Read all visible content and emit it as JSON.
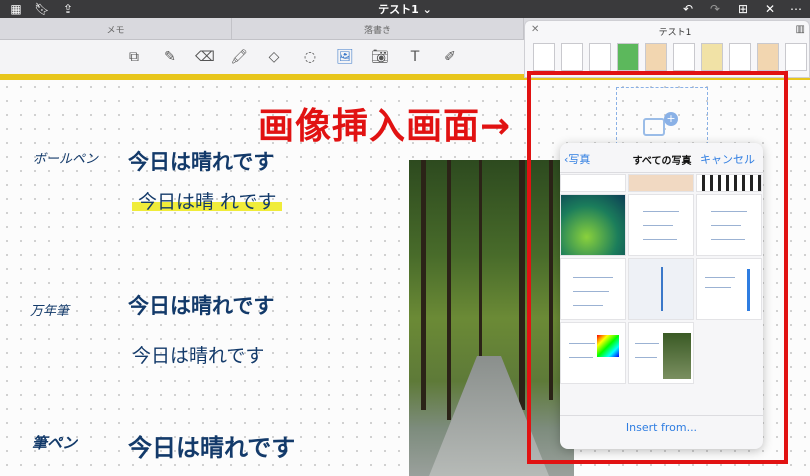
{
  "document": {
    "title": "テスト1 ⌄"
  },
  "tabs": [
    {
      "label": "メモ"
    },
    {
      "label": "落書き"
    }
  ],
  "toolbar": {
    "tools": [
      "page-icon",
      "pen-icon",
      "eraser-icon",
      "highlighter-icon",
      "shapes-icon",
      "lasso-icon",
      "image-icon",
      "camera-icon",
      "text-icon",
      "laser-icon"
    ]
  },
  "handwriting": {
    "ballpoint_label": "ボールペン",
    "fountain_label": "万年筆",
    "brush_label": "筆ペン",
    "sample_text": "今日は晴れです",
    "sample_text_spaced": "今日は晴 れです"
  },
  "mini_panel": {
    "title": "テスト1"
  },
  "picker": {
    "back_label": "写真",
    "title": "すべての写真",
    "cancel_label": "キャンセル",
    "insert_label": "Insert from..."
  },
  "annotation": {
    "text": "画像挿入画面→"
  },
  "colors": {
    "accent": "#2f7de1",
    "highlight": "#e8c61b",
    "annotation": "#e11212",
    "ink": "#133a6a"
  }
}
